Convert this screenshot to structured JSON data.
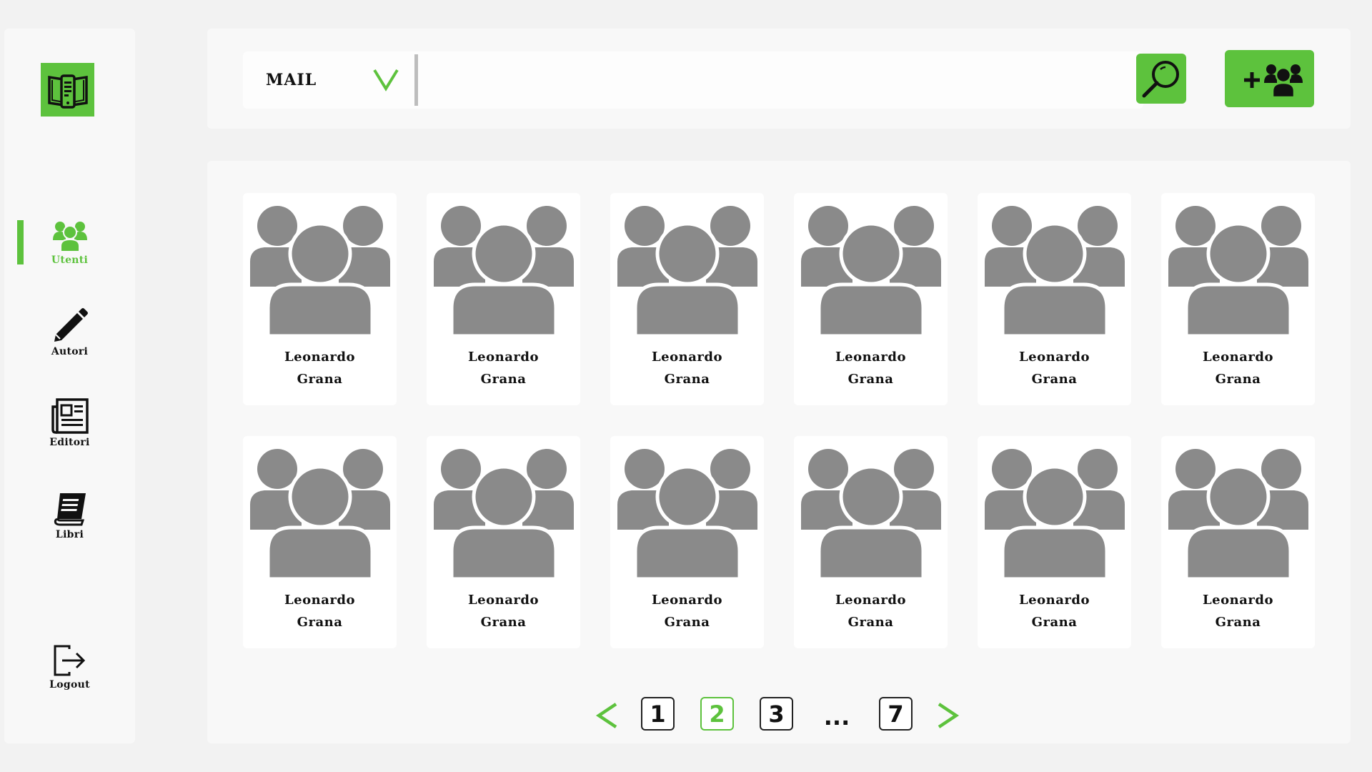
{
  "sidebar": {
    "logo_icon": "book-phone-icon",
    "items": [
      {
        "label": "Utenti",
        "icon": "users-icon",
        "active": true
      },
      {
        "label": "Autori",
        "icon": "pencil-icon",
        "active": false
      },
      {
        "label": "Editori",
        "icon": "newspaper-icon",
        "active": false
      },
      {
        "label": "Libri",
        "icon": "book-icon",
        "active": false
      }
    ],
    "logout_label": "Logout",
    "logout_icon": "logout-icon"
  },
  "search": {
    "filter_label": "MAIL",
    "query": "",
    "search_icon": "search-icon",
    "add_icon": "add-users-icon"
  },
  "users": [
    {
      "first": "Leonardo",
      "last": "Grana"
    },
    {
      "first": "Leonardo",
      "last": "Grana"
    },
    {
      "first": "Leonardo",
      "last": "Grana"
    },
    {
      "first": "Leonardo",
      "last": "Grana"
    },
    {
      "first": "Leonardo",
      "last": "Grana"
    },
    {
      "first": "Leonardo",
      "last": "Grana"
    },
    {
      "first": "Leonardo",
      "last": "Grana"
    },
    {
      "first": "Leonardo",
      "last": "Grana"
    },
    {
      "first": "Leonardo",
      "last": "Grana"
    },
    {
      "first": "Leonardo",
      "last": "Grana"
    },
    {
      "first": "Leonardo",
      "last": "Grana"
    },
    {
      "first": "Leonardo",
      "last": "Grana"
    }
  ],
  "pagination": {
    "pages": [
      "1",
      "2",
      "3",
      "7"
    ],
    "current": "2",
    "ellipsis": "..."
  },
  "colors": {
    "accent": "#5dc23d",
    "avatar": "#8a8a8a",
    "text": "#111111"
  }
}
